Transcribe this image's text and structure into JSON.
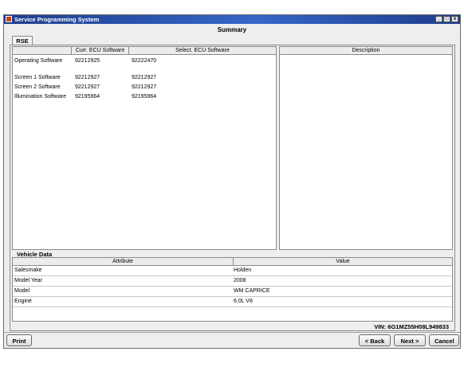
{
  "window": {
    "title": "Service Programming System"
  },
  "page": {
    "heading": "Summary"
  },
  "tabs": [
    {
      "label": "RSE"
    }
  ],
  "software_table": {
    "columns": [
      "",
      "Curr. ECU Software",
      "Select. ECU Software"
    ],
    "rows": [
      {
        "name": "Operating Software",
        "current": "92212925",
        "selected": "92222470"
      },
      {
        "name": "Screen 1 Software",
        "current": "92212927",
        "selected": "92212927"
      },
      {
        "name": "Screen 2 Software",
        "current": "92212927",
        "selected": "92212927"
      },
      {
        "name": "Illumination Software",
        "current": "92195964",
        "selected": "92195964"
      }
    ]
  },
  "description_table": {
    "columns": [
      "Description"
    ]
  },
  "vehicle_data": {
    "title": "Vehicle Data",
    "columns": [
      "Attribute",
      "Value"
    ],
    "rows": [
      {
        "attribute": "Salesmake",
        "value": "Holden"
      },
      {
        "attribute": "Model Year",
        "value": "2008"
      },
      {
        "attribute": "Model",
        "value": "WM CAPRICE"
      },
      {
        "attribute": "Engine",
        "value": "6.0L V8"
      }
    ]
  },
  "vin": "VIN: 6G1MZ55H08L949833",
  "buttons": {
    "print": "Print",
    "back": "< Back",
    "next": "Next >",
    "cancel": "Cancel"
  },
  "window_controls": {
    "minimize": "_",
    "maximize": "□",
    "close": "x"
  }
}
